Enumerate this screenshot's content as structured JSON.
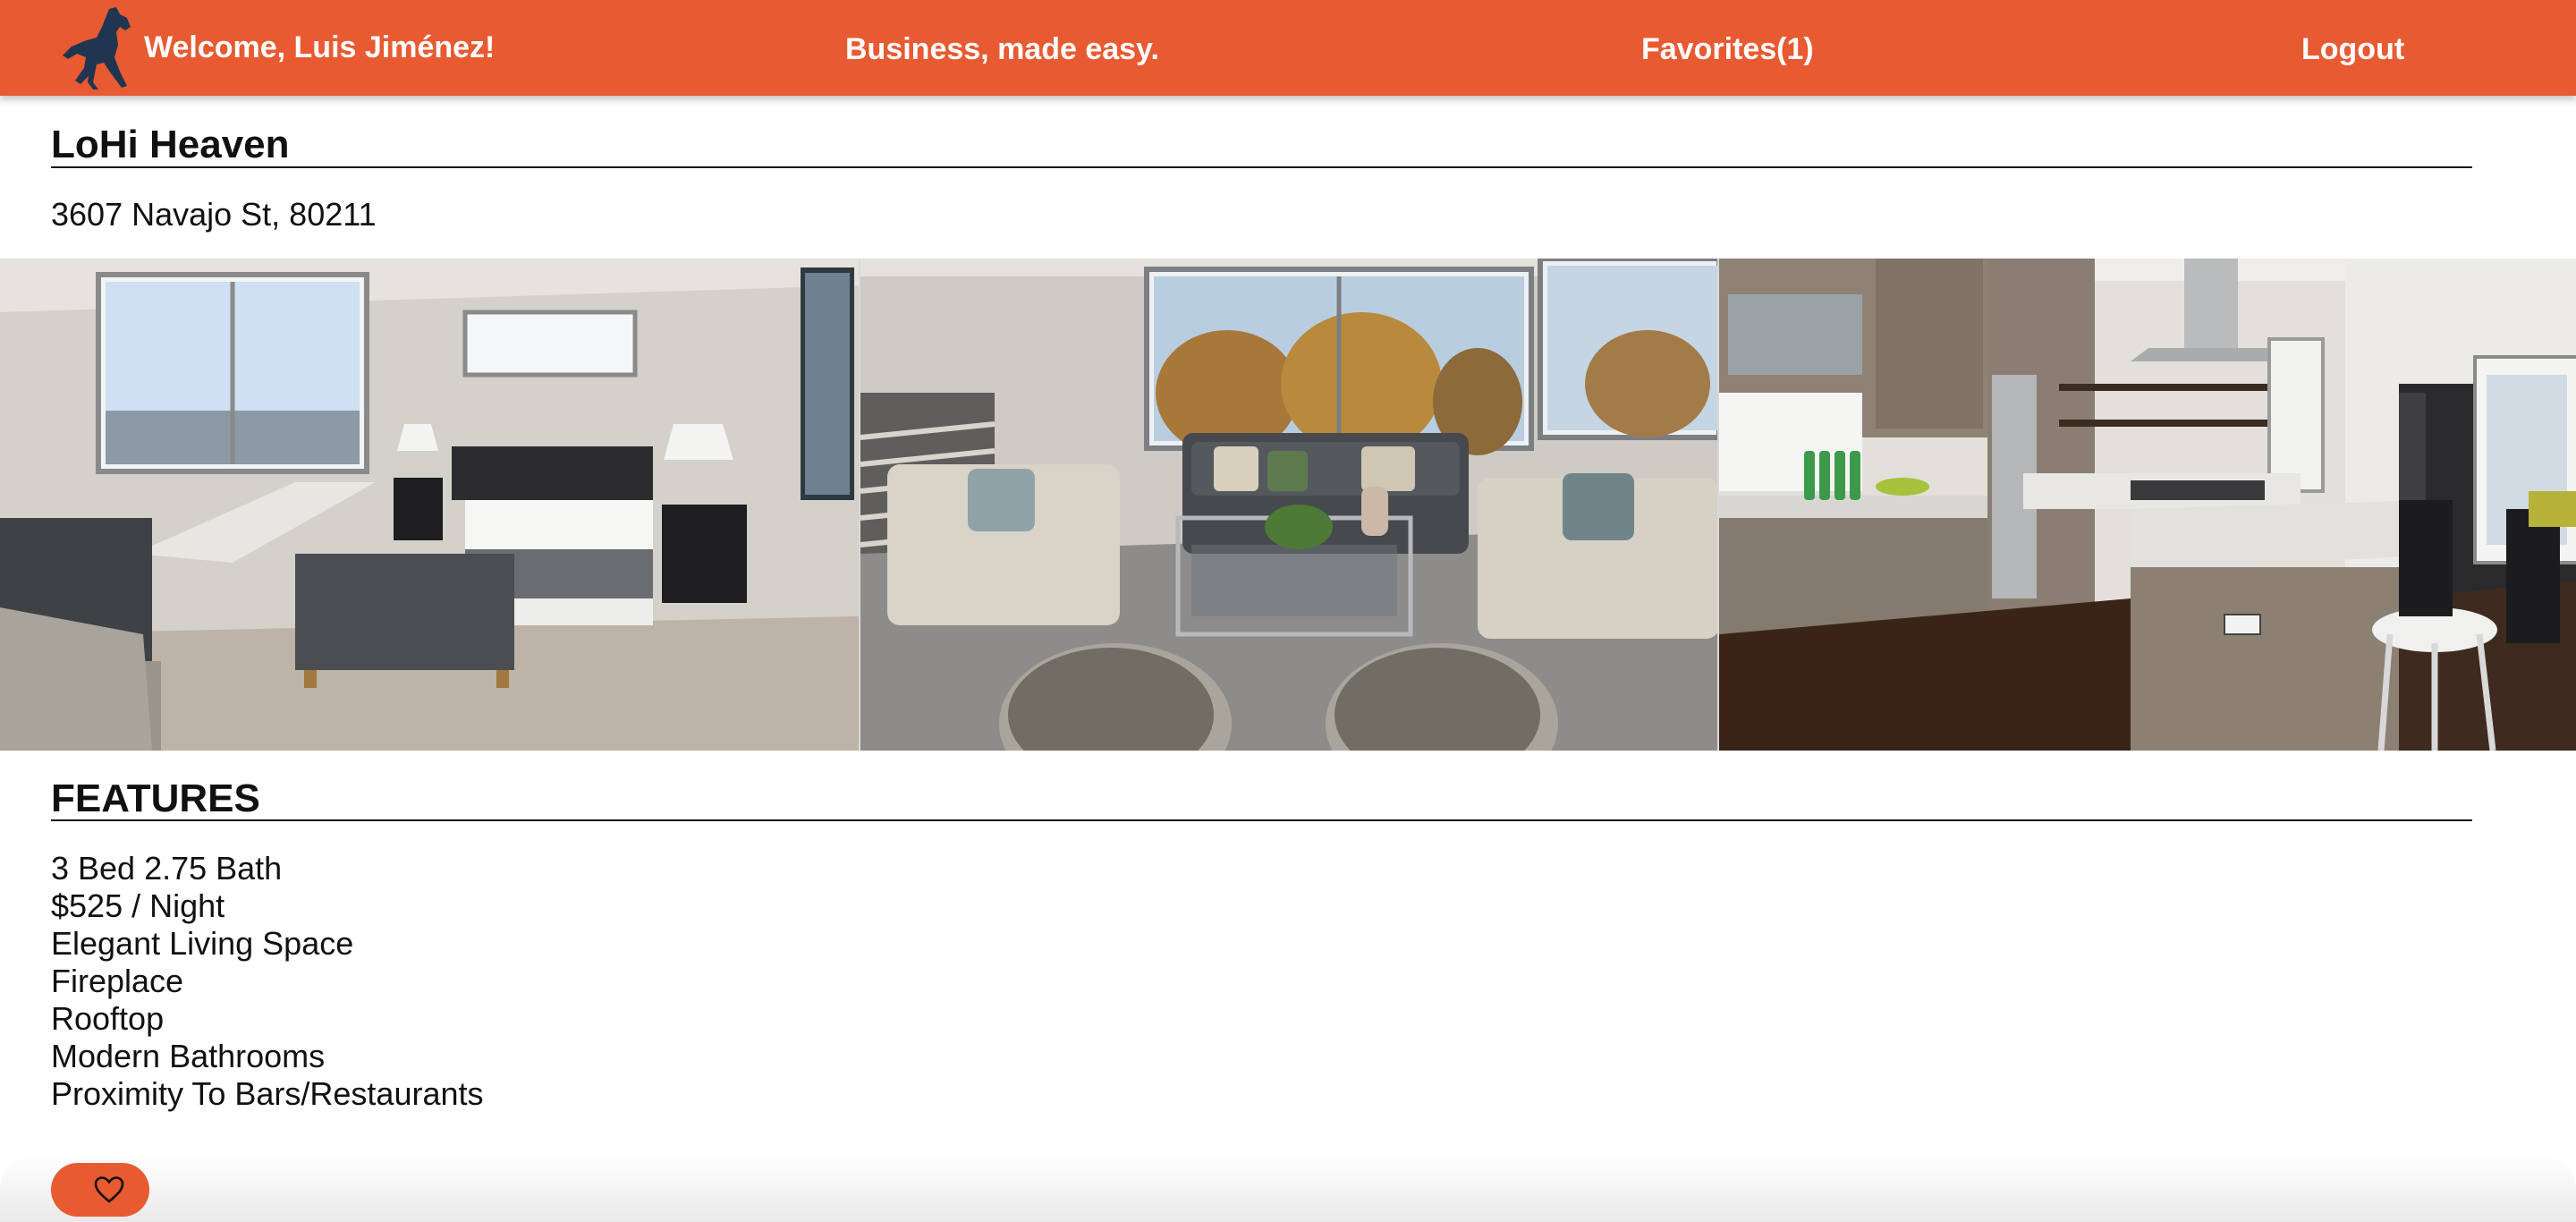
{
  "navbar": {
    "logo_icon": "rearing-horse-logo",
    "welcome": "Welcome, Luis Jiménez!",
    "tagline": "Business, made easy.",
    "favorites": "Favorites(1)",
    "logout": "Logout"
  },
  "listing": {
    "title": "LoHi Heaven",
    "address": "3607 Navajo St, 80211"
  },
  "gallery": [
    {
      "subject": "bedroom-photo"
    },
    {
      "subject": "living-room-photo"
    },
    {
      "subject": "kitchen-photo"
    }
  ],
  "features": {
    "heading": "FEATURES",
    "items": [
      "3 Bed 2.75 Bath",
      "$525 / Night",
      "Elegant Living Space",
      "Fireplace",
      "Rooftop",
      "Modern Bathrooms",
      "Proximity To Bars/Restaurants"
    ]
  },
  "favorite_button": {
    "icon": "heart-outline-icon"
  },
  "colors": {
    "accent": "#e85a31",
    "text": "#111111",
    "logo": "#1f3550"
  }
}
